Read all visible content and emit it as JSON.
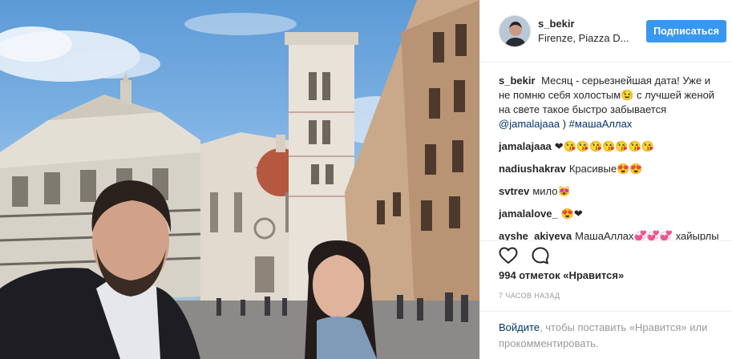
{
  "header": {
    "username": "s_bekir",
    "location": "Firenze, Piazza D...",
    "follow_label": "Подписаться"
  },
  "caption": {
    "username": "s_bekir",
    "text": "Месяц - серьезнейшая дата! Уже и не помню себя холостым😉 с лучшей женой на свете такое быстро забывается",
    "mention": "@jamalajaaa",
    "tail": ")",
    "hashtag": "#машаАллах"
  },
  "comments": [
    {
      "username": "jamalajaaa",
      "text": "❤😘😘😘😘😘😘😘"
    },
    {
      "username": "nadiushakrav",
      "text": "Красивые😍😍"
    },
    {
      "username": "svtrev",
      "text": "мило😻"
    },
    {
      "username": "jamalalove_",
      "text": "😍❤"
    },
    {
      "username": "ayshe_akiyeva",
      "text": "МашаАллах💞💞💞 хайырлы олсун))))"
    }
  ],
  "actions": {
    "like_icon": "heart-icon",
    "comment_icon": "comment-icon"
  },
  "likes_text": "994 отметок «Нравится»",
  "time_text": "7 часов назад",
  "login": {
    "link_text": "Войдите",
    "rest_text": ", чтобы поставить «Нравится» или прокомментировать."
  },
  "colors": {
    "accent": "#3897f0",
    "link": "#003569",
    "muted": "#999999",
    "border": "#efefef"
  }
}
